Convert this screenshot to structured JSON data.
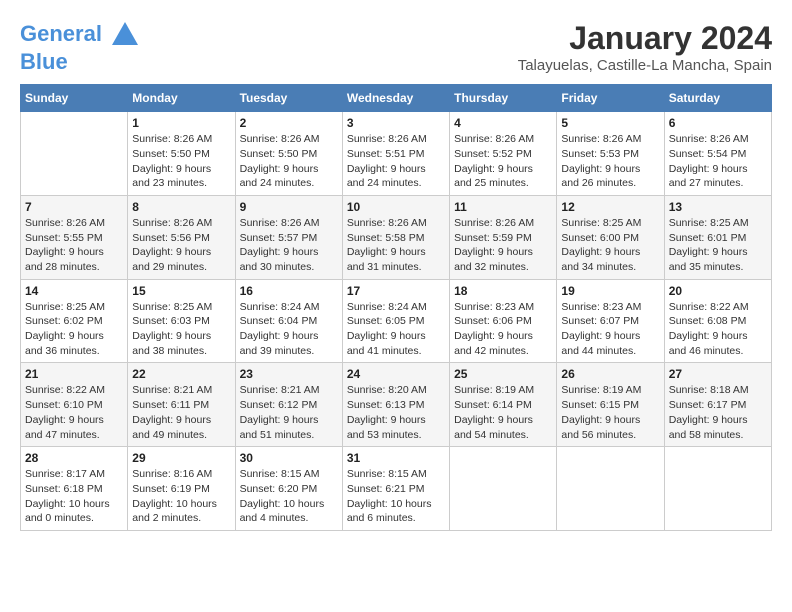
{
  "header": {
    "logo_line1": "General",
    "logo_line2": "Blue",
    "title": "January 2024",
    "subtitle": "Talayuelas, Castille-La Mancha, Spain"
  },
  "days_of_week": [
    "Sunday",
    "Monday",
    "Tuesday",
    "Wednesday",
    "Thursday",
    "Friday",
    "Saturday"
  ],
  "weeks": [
    [
      {
        "day": "",
        "sunrise": "",
        "sunset": "",
        "daylight": ""
      },
      {
        "day": "1",
        "sunrise": "Sunrise: 8:26 AM",
        "sunset": "Sunset: 5:50 PM",
        "daylight": "Daylight: 9 hours and 23 minutes."
      },
      {
        "day": "2",
        "sunrise": "Sunrise: 8:26 AM",
        "sunset": "Sunset: 5:50 PM",
        "daylight": "Daylight: 9 hours and 24 minutes."
      },
      {
        "day": "3",
        "sunrise": "Sunrise: 8:26 AM",
        "sunset": "Sunset: 5:51 PM",
        "daylight": "Daylight: 9 hours and 24 minutes."
      },
      {
        "day": "4",
        "sunrise": "Sunrise: 8:26 AM",
        "sunset": "Sunset: 5:52 PM",
        "daylight": "Daylight: 9 hours and 25 minutes."
      },
      {
        "day": "5",
        "sunrise": "Sunrise: 8:26 AM",
        "sunset": "Sunset: 5:53 PM",
        "daylight": "Daylight: 9 hours and 26 minutes."
      },
      {
        "day": "6",
        "sunrise": "Sunrise: 8:26 AM",
        "sunset": "Sunset: 5:54 PM",
        "daylight": "Daylight: 9 hours and 27 minutes."
      }
    ],
    [
      {
        "day": "7",
        "sunrise": "Sunrise: 8:26 AM",
        "sunset": "Sunset: 5:55 PM",
        "daylight": "Daylight: 9 hours and 28 minutes."
      },
      {
        "day": "8",
        "sunrise": "Sunrise: 8:26 AM",
        "sunset": "Sunset: 5:56 PM",
        "daylight": "Daylight: 9 hours and 29 minutes."
      },
      {
        "day": "9",
        "sunrise": "Sunrise: 8:26 AM",
        "sunset": "Sunset: 5:57 PM",
        "daylight": "Daylight: 9 hours and 30 minutes."
      },
      {
        "day": "10",
        "sunrise": "Sunrise: 8:26 AM",
        "sunset": "Sunset: 5:58 PM",
        "daylight": "Daylight: 9 hours and 31 minutes."
      },
      {
        "day": "11",
        "sunrise": "Sunrise: 8:26 AM",
        "sunset": "Sunset: 5:59 PM",
        "daylight": "Daylight: 9 hours and 32 minutes."
      },
      {
        "day": "12",
        "sunrise": "Sunrise: 8:25 AM",
        "sunset": "Sunset: 6:00 PM",
        "daylight": "Daylight: 9 hours and 34 minutes."
      },
      {
        "day": "13",
        "sunrise": "Sunrise: 8:25 AM",
        "sunset": "Sunset: 6:01 PM",
        "daylight": "Daylight: 9 hours and 35 minutes."
      }
    ],
    [
      {
        "day": "14",
        "sunrise": "Sunrise: 8:25 AM",
        "sunset": "Sunset: 6:02 PM",
        "daylight": "Daylight: 9 hours and 36 minutes."
      },
      {
        "day": "15",
        "sunrise": "Sunrise: 8:25 AM",
        "sunset": "Sunset: 6:03 PM",
        "daylight": "Daylight: 9 hours and 38 minutes."
      },
      {
        "day": "16",
        "sunrise": "Sunrise: 8:24 AM",
        "sunset": "Sunset: 6:04 PM",
        "daylight": "Daylight: 9 hours and 39 minutes."
      },
      {
        "day": "17",
        "sunrise": "Sunrise: 8:24 AM",
        "sunset": "Sunset: 6:05 PM",
        "daylight": "Daylight: 9 hours and 41 minutes."
      },
      {
        "day": "18",
        "sunrise": "Sunrise: 8:23 AM",
        "sunset": "Sunset: 6:06 PM",
        "daylight": "Daylight: 9 hours and 42 minutes."
      },
      {
        "day": "19",
        "sunrise": "Sunrise: 8:23 AM",
        "sunset": "Sunset: 6:07 PM",
        "daylight": "Daylight: 9 hours and 44 minutes."
      },
      {
        "day": "20",
        "sunrise": "Sunrise: 8:22 AM",
        "sunset": "Sunset: 6:08 PM",
        "daylight": "Daylight: 9 hours and 46 minutes."
      }
    ],
    [
      {
        "day": "21",
        "sunrise": "Sunrise: 8:22 AM",
        "sunset": "Sunset: 6:10 PM",
        "daylight": "Daylight: 9 hours and 47 minutes."
      },
      {
        "day": "22",
        "sunrise": "Sunrise: 8:21 AM",
        "sunset": "Sunset: 6:11 PM",
        "daylight": "Daylight: 9 hours and 49 minutes."
      },
      {
        "day": "23",
        "sunrise": "Sunrise: 8:21 AM",
        "sunset": "Sunset: 6:12 PM",
        "daylight": "Daylight: 9 hours and 51 minutes."
      },
      {
        "day": "24",
        "sunrise": "Sunrise: 8:20 AM",
        "sunset": "Sunset: 6:13 PM",
        "daylight": "Daylight: 9 hours and 53 minutes."
      },
      {
        "day": "25",
        "sunrise": "Sunrise: 8:19 AM",
        "sunset": "Sunset: 6:14 PM",
        "daylight": "Daylight: 9 hours and 54 minutes."
      },
      {
        "day": "26",
        "sunrise": "Sunrise: 8:19 AM",
        "sunset": "Sunset: 6:15 PM",
        "daylight": "Daylight: 9 hours and 56 minutes."
      },
      {
        "day": "27",
        "sunrise": "Sunrise: 8:18 AM",
        "sunset": "Sunset: 6:17 PM",
        "daylight": "Daylight: 9 hours and 58 minutes."
      }
    ],
    [
      {
        "day": "28",
        "sunrise": "Sunrise: 8:17 AM",
        "sunset": "Sunset: 6:18 PM",
        "daylight": "Daylight: 10 hours and 0 minutes."
      },
      {
        "day": "29",
        "sunrise": "Sunrise: 8:16 AM",
        "sunset": "Sunset: 6:19 PM",
        "daylight": "Daylight: 10 hours and 2 minutes."
      },
      {
        "day": "30",
        "sunrise": "Sunrise: 8:15 AM",
        "sunset": "Sunset: 6:20 PM",
        "daylight": "Daylight: 10 hours and 4 minutes."
      },
      {
        "day": "31",
        "sunrise": "Sunrise: 8:15 AM",
        "sunset": "Sunset: 6:21 PM",
        "daylight": "Daylight: 10 hours and 6 minutes."
      },
      {
        "day": "",
        "sunrise": "",
        "sunset": "",
        "daylight": ""
      },
      {
        "day": "",
        "sunrise": "",
        "sunset": "",
        "daylight": ""
      },
      {
        "day": "",
        "sunrise": "",
        "sunset": "",
        "daylight": ""
      }
    ]
  ]
}
